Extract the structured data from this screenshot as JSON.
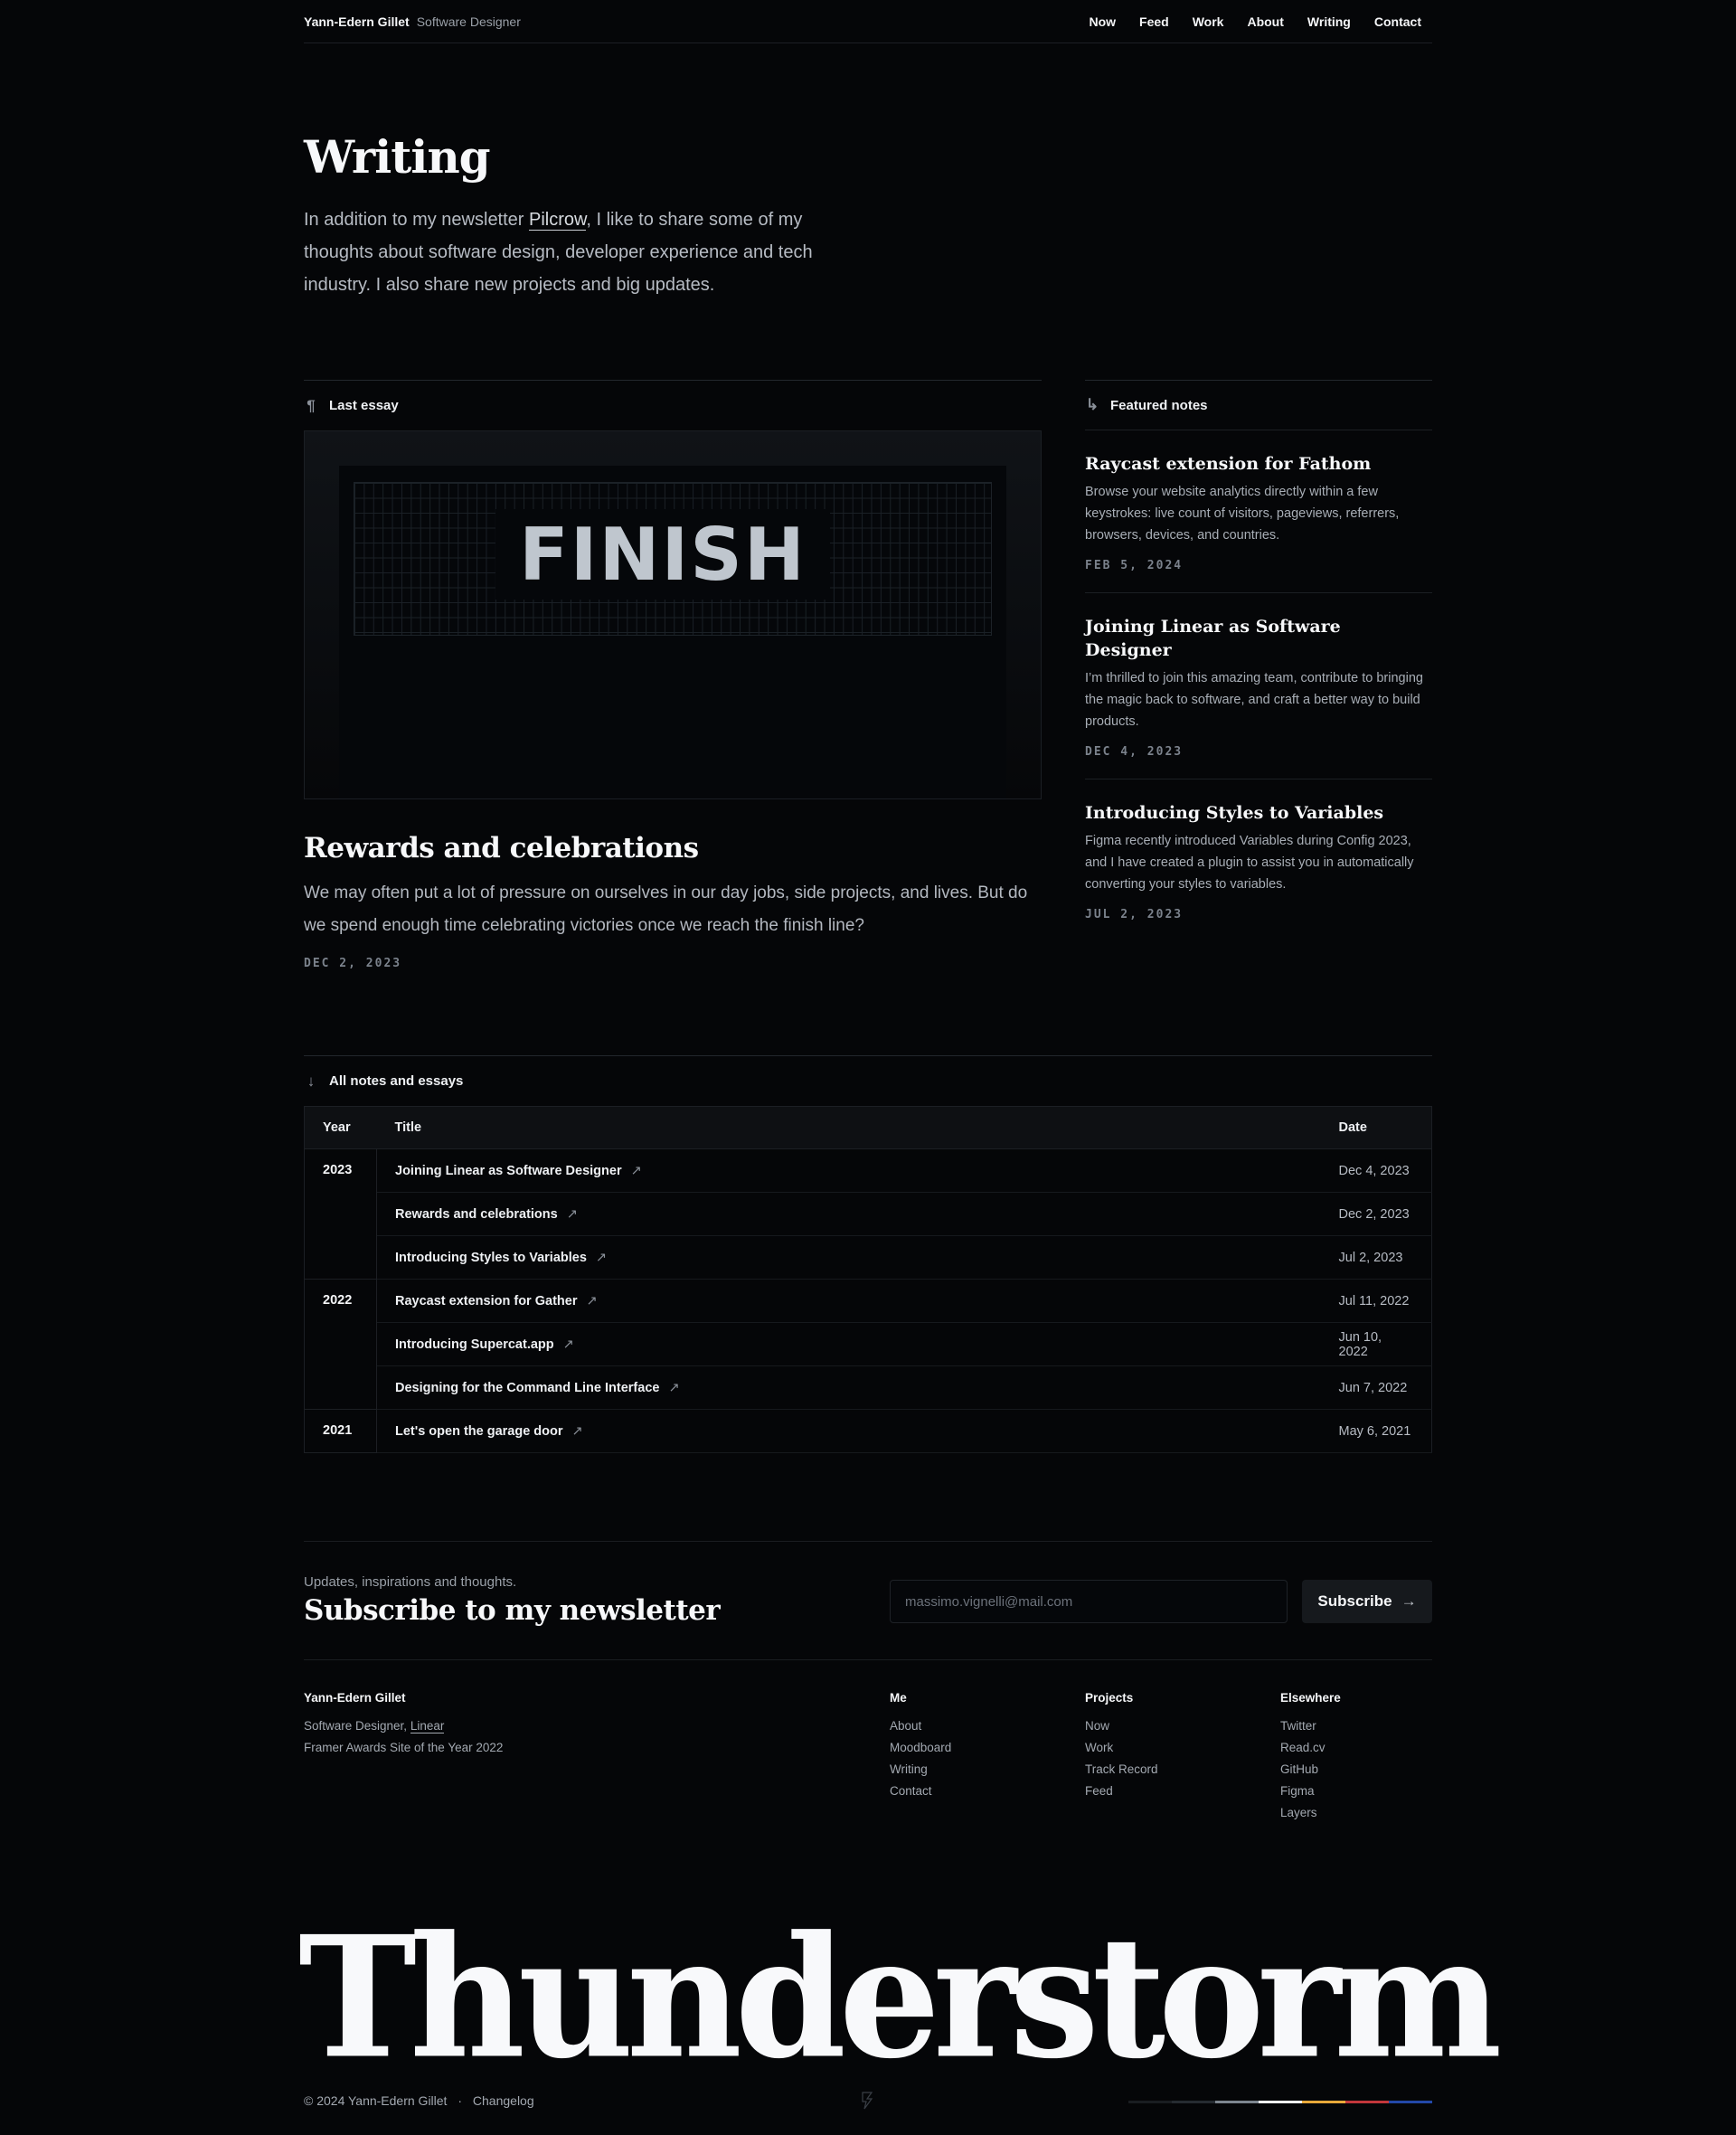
{
  "header": {
    "name": "Yann-Edern Gillet",
    "role": "Software Designer",
    "nav": [
      "Now",
      "Feed",
      "Work",
      "About",
      "Writing",
      "Contact"
    ]
  },
  "hero": {
    "title": "Writing",
    "intro_before": "In addition to my newsletter ",
    "intro_link": "Pilcrow",
    "intro_after": ", I like to share some of my thoughts about software design, developer experience and tech industry. I also share new projects and big updates."
  },
  "last_essay": {
    "section_icon": "pilcrow-icon",
    "section_label": "Last essay",
    "cover_text": "FINISH",
    "title": "Rewards and celebrations",
    "description": "We may often put a lot of pressure on ourselves in our day jobs, side projects, and lives. But do we spend enough time celebrating victories once we reach the finish line?",
    "date": "DEC 2, 2023"
  },
  "featured": {
    "section_icon": "arrow-down-right-icon",
    "section_label": "Featured notes",
    "notes": [
      {
        "title": "Raycast extension for Fathom",
        "description": "Browse your website analytics directly within a few keystrokes: live count of visitors, pageviews, referrers, browsers, devices, and countries.",
        "date": "FEB 5, 2024"
      },
      {
        "title": "Joining Linear as Software Designer",
        "description": "I’m thrilled to join this amazing team, contribute to bringing the magic back to software, and craft a better way to build products.",
        "date": "DEC 4, 2023"
      },
      {
        "title": "Introducing Styles to Variables",
        "description": "Figma recently introduced Variables during Config 2023, and I have created a plugin to assist you in automatically converting your styles to variables.",
        "date": "JUL 2, 2023"
      }
    ]
  },
  "all_notes": {
    "section_icon": "arrow-down-icon",
    "section_label": "All notes and essays",
    "columns": [
      "Year",
      "Title",
      "Date"
    ],
    "groups": [
      {
        "year": "2023",
        "rows": [
          {
            "title": "Joining Linear as Software Designer",
            "date": "Dec 4, 2023"
          },
          {
            "title": "Rewards and celebrations",
            "date": "Dec 2, 2023"
          },
          {
            "title": "Introducing Styles to Variables",
            "date": "Jul 2, 2023"
          }
        ]
      },
      {
        "year": "2022",
        "rows": [
          {
            "title": "Raycast extension for Gather",
            "date": "Jul 11, 2022"
          },
          {
            "title": "Introducing Supercat.app",
            "date": "Jun 10, 2022"
          },
          {
            "title": "Designing for the Command Line Interface",
            "date": "Jun 7, 2022"
          }
        ]
      },
      {
        "year": "2021",
        "rows": [
          {
            "title": "Let's open the garage door",
            "date": "May 6, 2021"
          }
        ]
      }
    ]
  },
  "newsletter": {
    "subtitle": "Updates, inspirations and thoughts.",
    "title": "Subscribe to my newsletter",
    "email_placeholder": "massimo.vignelli@mail.com",
    "button_label": "Subscribe",
    "button_icon": "arrow-right-icon"
  },
  "footer": {
    "name": "Yann-Edern Gillet",
    "line1_before": "Software Designer, ",
    "line1_link": "Linear",
    "line2": "Framer Awards Site of the Year 2022",
    "columns": [
      {
        "heading": "Me",
        "items": [
          "About",
          "Moodboard",
          "Writing",
          "Contact"
        ]
      },
      {
        "heading": "Projects",
        "items": [
          "Now",
          "Work",
          "Track Record",
          "Feed"
        ]
      },
      {
        "heading": "Elsewhere",
        "items": [
          "Twitter",
          "Read.cv",
          "GitHub",
          "Figma",
          "Layers"
        ]
      }
    ],
    "wordmark": "Thunderstorm",
    "copyright": "© 2024 Yann-Edern Gillet",
    "separator": "·",
    "changelog": "Changelog",
    "palette": [
      "#1a1d21",
      "#262b31",
      "#7d858f",
      "#f5f6f8",
      "#e8a93a",
      "#c2373b",
      "#2348a8"
    ]
  }
}
